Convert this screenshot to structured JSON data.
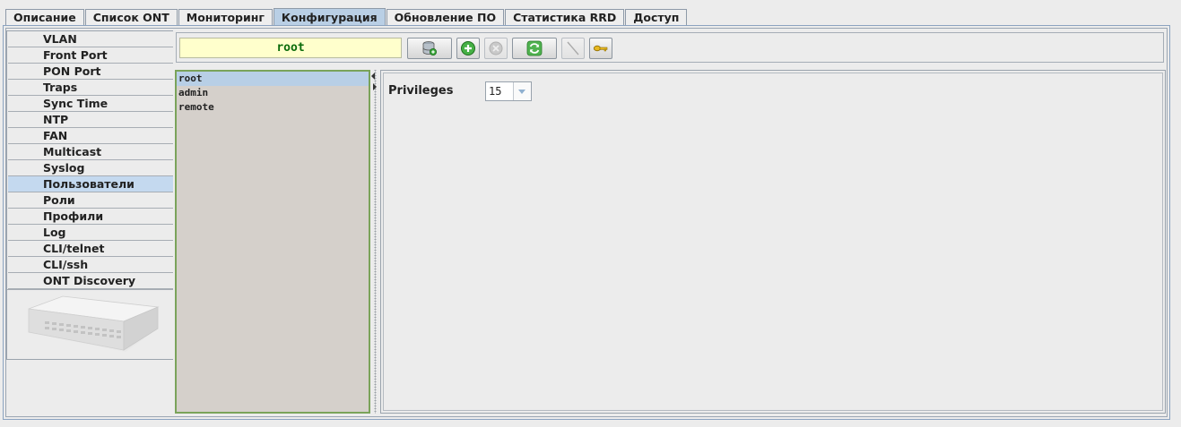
{
  "tabs": [
    {
      "label": "Описание"
    },
    {
      "label": "Список ONT"
    },
    {
      "label": "Мониторинг"
    },
    {
      "label": "Конфигурация",
      "active": true
    },
    {
      "label": "Обновление ПО"
    },
    {
      "label": "Статистика RRD"
    },
    {
      "label": "Доступ"
    }
  ],
  "sidebar": {
    "items": [
      {
        "label": "VLAN"
      },
      {
        "label": "Front Port"
      },
      {
        "label": "PON Port"
      },
      {
        "label": "Traps"
      },
      {
        "label": "Sync Time"
      },
      {
        "label": "NTP"
      },
      {
        "label": "FAN"
      },
      {
        "label": "Multicast"
      },
      {
        "label": "Syslog"
      },
      {
        "label": "Пользователи",
        "active": true
      },
      {
        "label": "Роли"
      },
      {
        "label": "Профили"
      },
      {
        "label": "Log"
      },
      {
        "label": "CLI/telnet"
      },
      {
        "label": "CLI/ssh"
      },
      {
        "label": "ONT Discovery"
      }
    ]
  },
  "toolbar": {
    "current_user": "root"
  },
  "users": {
    "items": [
      {
        "name": "root",
        "selected": true
      },
      {
        "name": "admin"
      },
      {
        "name": "remote"
      }
    ]
  },
  "details": {
    "privileges_label": "Privileges",
    "privileges_value": "15"
  },
  "colors": {
    "active_tab": "#b9cfe5",
    "selected_row": "#b8cfe6",
    "list_border": "#7aa35a",
    "user_field_bg": "#ffffcc",
    "user_field_text": "#0a6b0a"
  }
}
